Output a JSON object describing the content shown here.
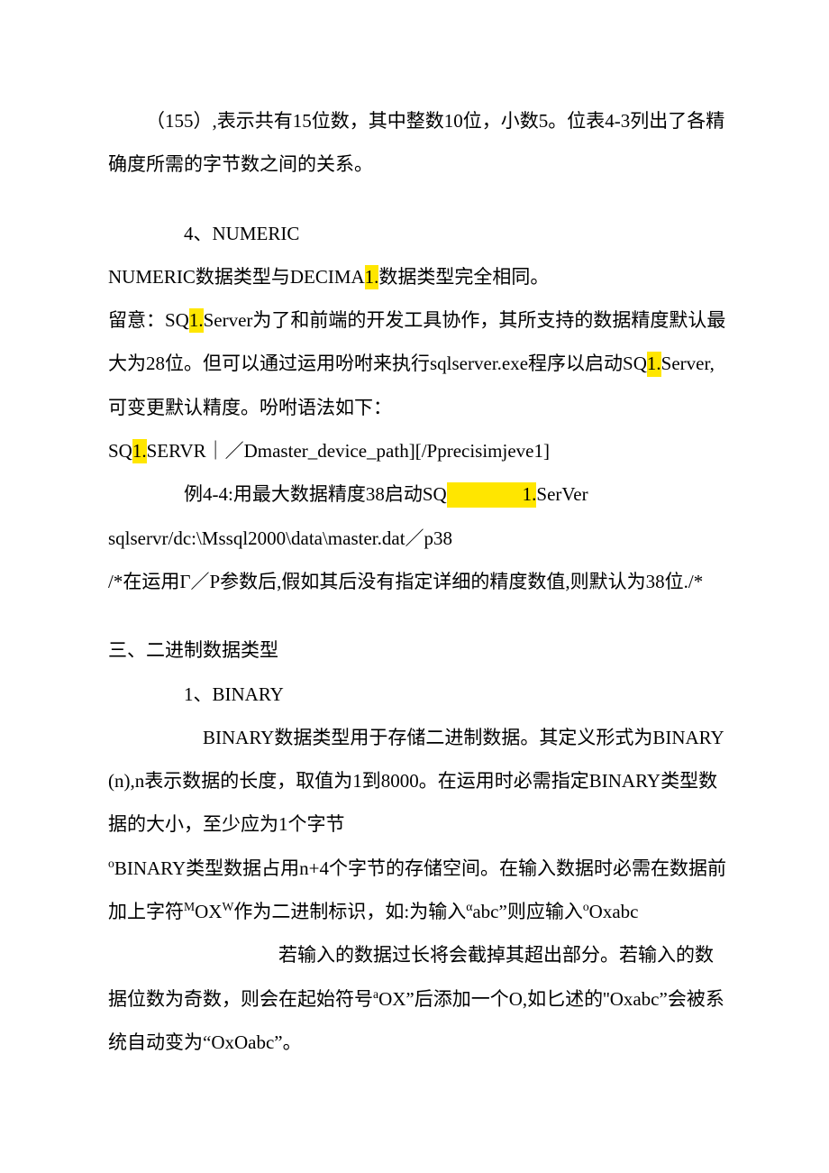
{
  "p1_prefix": "（155）,表示共有15位数，其中整数10位，小数5。位表4-3列出了各精确度所需的字节数之间的关系。",
  "h4": "4、NUMERIC",
  "p2a": "NUMERIC数据类型与DECIMA",
  "p2b_hl": "1.",
  "p2c": "数据类型完全相同。",
  "p3a": "留意：SQ",
  "p3b_hl": "1.",
  "p3c": "Server为了和前端的开发工具协作，其所支持的数据精度默认最大为28位。但可以通过运用吩咐来执行sqlserver.exe程序以启动SQ",
  "p3d_hl": "1.",
  "p3e": "Server,可变更默认精度。吩咐语法如下：",
  "p4a": "SQ",
  "p4b_hl": "1.",
  "p4c": "SERVR｜／Dmaster_device_path][/Pprecisimjeve1]",
  "p5a": "例4-4:用最大数据精度38启动SQ",
  "p5b_hl": "1.",
  "p5c": "SerVer",
  "p6": "sqlservr/dc:\\Mssql2000\\data\\master.dat／p38",
  "p7": "/*在运用Γ／P参数后,假如其后没有指定详细的精度数值,则默认为38位./*",
  "h3_3": "三、二进制数据类型",
  "h3_3_1": "1、BINARY",
  "p8a": "BINARY数据类型用于存储二进制数据。其定义形式为BINARY(n),n表示数据的长度，取值为1到8000。在运用时必需指定BINARY类型数据的大小，至少应为1个字节",
  "p8b_sup": "o",
  "p8c": "BINARY类型数据占用n+4个字节的存储空间。在输入数据时必需在数据前加上字符",
  "p8d_sup": "M",
  "p8e": "OX",
  "p8f_sup": "W",
  "p8g": "作为二进制标识，如:为输入",
  "p8h_sup": "α",
  "p8i": "abc”则应输入",
  "p8j_sup": "o",
  "p8k": "Oxabc",
  "p8l": "若输入的数据过长将会截掉其超出部分。若输入的数据位数为奇数，则会在起始符号",
  "p8m_sup": "a",
  "p8n": "OX”后添加一个O,如匕述的''Oxabc”会被系统自动变为“OxOabc”。"
}
